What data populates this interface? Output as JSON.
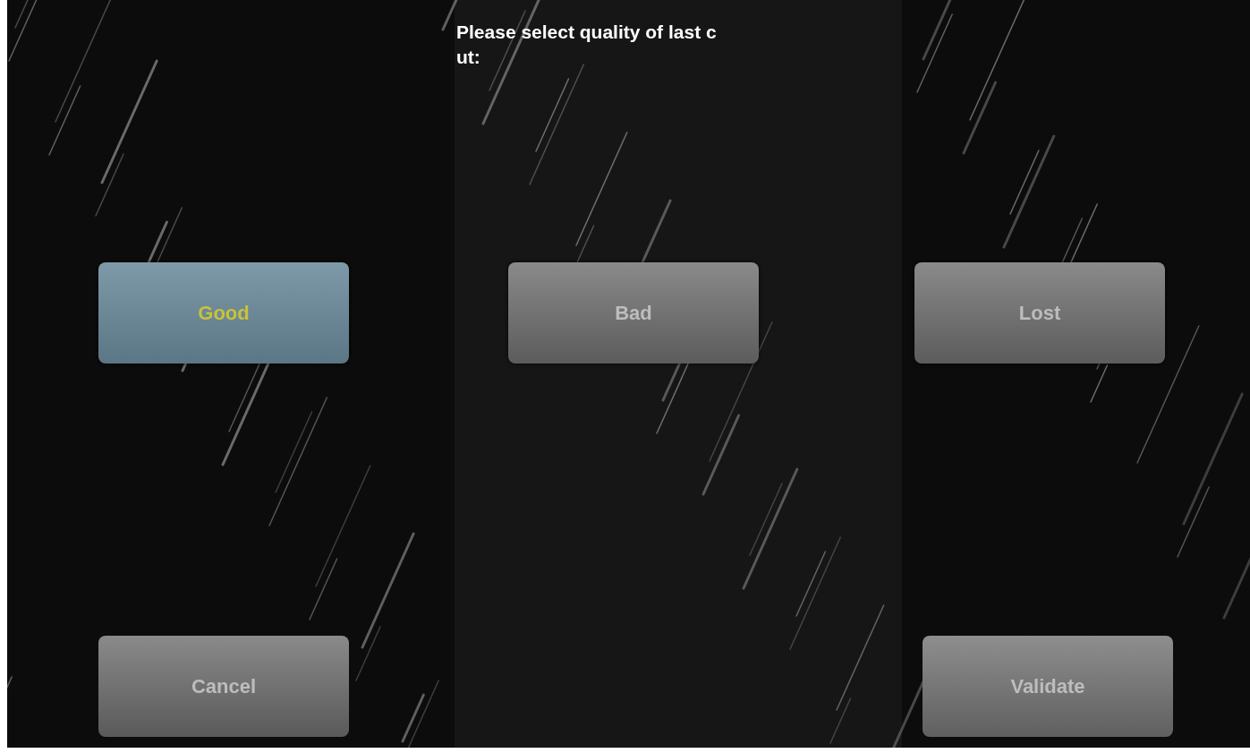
{
  "prompt": {
    "lines": [
      "Please select quality of last c",
      "ut:"
    ]
  },
  "quality_options": [
    {
      "label": "Good",
      "selected": true
    },
    {
      "label": "Bad",
      "selected": false
    },
    {
      "label": "Lost",
      "selected": false
    }
  ],
  "actions": [
    {
      "label": "Cancel",
      "kind": "cancel"
    },
    {
      "label": "Validate",
      "kind": "validate"
    }
  ]
}
